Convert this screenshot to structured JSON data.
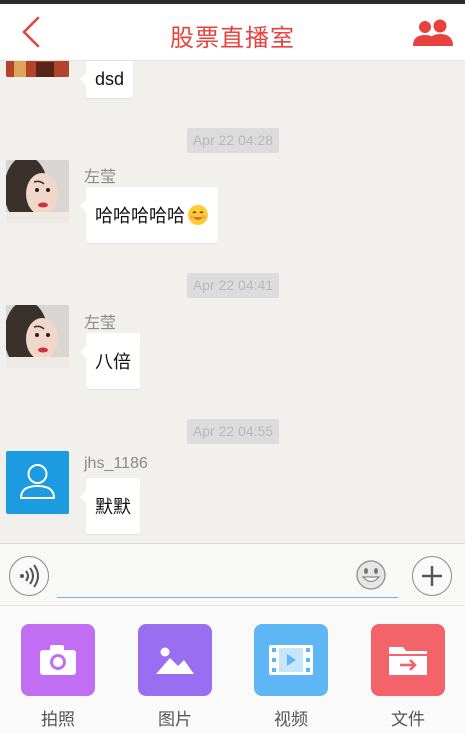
{
  "header": {
    "title": "股票直播室",
    "accent_color": "#e8423f"
  },
  "messages": [
    {
      "sender": "",
      "text": "dsd"
    },
    {
      "time": "Apr 22 04:28",
      "sender": "左莹",
      "text": "哈哈哈哈哈"
    },
    {
      "time": "Apr 22 04:41",
      "sender": "左莹",
      "text": "八倍"
    },
    {
      "time": "Apr 22 04:55",
      "sender": "jhs_1186",
      "text": "默默"
    }
  ],
  "input": {
    "value": "",
    "placeholder": ""
  },
  "tools": [
    {
      "label": "拍照",
      "icon": "camera-icon",
      "color": "#c26ef2"
    },
    {
      "label": "图片",
      "icon": "image-icon",
      "color": "#9a6ef0"
    },
    {
      "label": "视频",
      "icon": "video-icon",
      "color": "#5fb6f5"
    },
    {
      "label": "文件",
      "icon": "folder-icon",
      "color": "#f3646a"
    }
  ]
}
